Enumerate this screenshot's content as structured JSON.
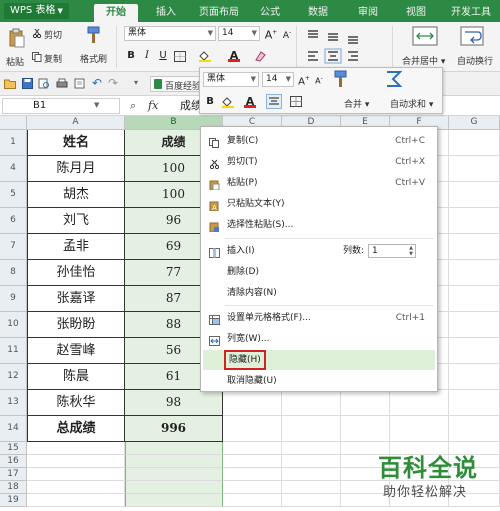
{
  "app": {
    "name": "WPS 表格"
  },
  "tabs": [
    "开始",
    "插入",
    "页面布局",
    "公式",
    "数据",
    "审阅",
    "视图",
    "开发工具"
  ],
  "ribbon": {
    "paste": "粘贴",
    "cut": "剪切",
    "copy": "复制",
    "format_painter": "格式刷",
    "font_name": "黑体",
    "font_size": "14",
    "merge_center": "合并居中",
    "auto_wrap": "自动换行"
  },
  "qat": {
    "baidu": "百度经验"
  },
  "formula_bar": {
    "cell_ref": "B1",
    "fx": "fx",
    "value": "成绩"
  },
  "mini_toolbar": {
    "font_name": "黑体",
    "font_size": "14",
    "merge": "合并",
    "autosum": "自动求和"
  },
  "columns": [
    "A",
    "B",
    "C",
    "D",
    "E",
    "F",
    "G"
  ],
  "row_numbers": [
    "1",
    "4",
    "5",
    "6",
    "7",
    "8",
    "9",
    "10",
    "11",
    "12",
    "13",
    "14",
    "15",
    "16",
    "17",
    "18",
    "19"
  ],
  "table": {
    "header": {
      "name": "姓名",
      "score": "成绩"
    },
    "rows": [
      {
        "name": "陈月月",
        "score": "100"
      },
      {
        "name": "胡杰",
        "score": "100"
      },
      {
        "name": "刘飞",
        "score": "96"
      },
      {
        "name": "孟非",
        "score": "69"
      },
      {
        "name": "孙佳怡",
        "score": "77"
      },
      {
        "name": "张嘉译",
        "score": "87"
      },
      {
        "name": "张盼盼",
        "score": "88"
      },
      {
        "name": "赵雪峰",
        "score": "56"
      },
      {
        "name": "陈晨",
        "score": "61"
      },
      {
        "name": "陈秋华",
        "score": "98"
      }
    ],
    "total": {
      "name": "总成绩",
      "score": "996"
    }
  },
  "context_menu": {
    "items": [
      {
        "label": "复制(C)",
        "shortcut": "Ctrl+C"
      },
      {
        "label": "剪切(T)",
        "shortcut": "Ctrl+X"
      },
      {
        "label": "粘贴(P)",
        "shortcut": "Ctrl+V"
      },
      {
        "label": "只粘贴文本(Y)",
        "shortcut": ""
      },
      {
        "label": "选择性粘贴(S)...",
        "shortcut": ""
      },
      {
        "label": "插入(I)",
        "shortcut": ""
      },
      {
        "label": "删除(D)",
        "shortcut": ""
      },
      {
        "label": "清除内容(N)",
        "shortcut": ""
      },
      {
        "label": "设置单元格格式(F)...",
        "shortcut": "Ctrl+1"
      },
      {
        "label": "列宽(W)...",
        "shortcut": ""
      },
      {
        "label": "隐藏(H)",
        "shortcut": ""
      },
      {
        "label": "取消隐藏(U)",
        "shortcut": ""
      }
    ],
    "columns_label": "列数:",
    "columns_value": "1"
  },
  "watermark": {
    "title": "百科全说",
    "subtitle": "助你轻松解决"
  },
  "colors": {
    "accent": "#2d8a44",
    "selection_fill": "#e4f0e1",
    "highlight_border": "#d0231f"
  }
}
